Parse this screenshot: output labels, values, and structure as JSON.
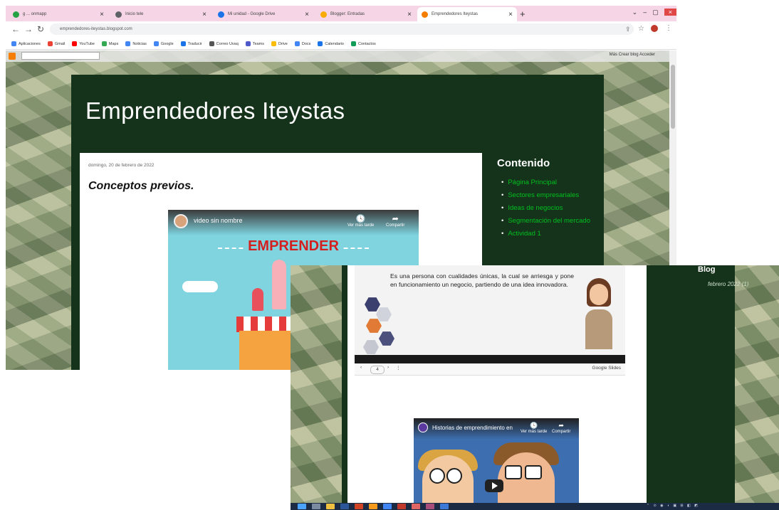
{
  "browser": {
    "tabs": [
      {
        "label": "g ... onmapp",
        "icon_color": "#25a244",
        "active": false
      },
      {
        "label": "Inicio tele",
        "icon_color": "#5f6368",
        "active": false
      },
      {
        "label": "Mi unidad - Google Drive",
        "icon_color": "#1a73e8",
        "active": false
      },
      {
        "label": "Blogger: Entradas",
        "icon_color": "#f9ab00",
        "active": false
      },
      {
        "label": "Emprendedores Iteystas",
        "icon_color": "#f57d00",
        "active": true
      }
    ],
    "address": "emprendedores-iteystas.blogspot.com",
    "bookmarks": [
      "Aplicaciones",
      "Gmail",
      "YouTube",
      "Maps",
      "Noticias",
      "Google",
      "Traducir",
      "Correo Uvaq",
      "Teams",
      "Drive",
      "Docs",
      "Calendario",
      "Contactos"
    ],
    "navbar_links": "Más   Crear blog   Acceder"
  },
  "blog": {
    "title": "Emprendedores Iteystas",
    "post_date": "domingo, 20 de febrero de 2022",
    "post_title": "Conceptos previos.",
    "video1": {
      "title": "video sin nombre",
      "watch_later": "Ver más tarde",
      "share": "Compartir",
      "banner": "EMPRENDER"
    },
    "sidebar_heading": "Contenido",
    "sidebar_links": [
      "Página Principal",
      "Sectores empresariales",
      "Ideas de negocios",
      "Segmentación del mercado",
      "Actividad 1"
    ]
  },
  "window2": {
    "slide_text": "Es una persona con cualidades únicas, la cual se arriesga y pone en funcionamiento un negocio, partiendo de una idea innovadora.",
    "slides_page": "4",
    "slides_brand": "Google Slides",
    "video2": {
      "title": "Historias de emprendimiento en",
      "watch_later": "Ver más tarde",
      "share": "Compartir"
    },
    "archive_heading": "Blog",
    "archive_item": "febrero 2022 (1)"
  },
  "colors": {
    "blog_bg": "#15321a",
    "link_green": "#00c020",
    "tab_strip": "#f6d6e6",
    "emprender_red": "#d41f1f"
  }
}
